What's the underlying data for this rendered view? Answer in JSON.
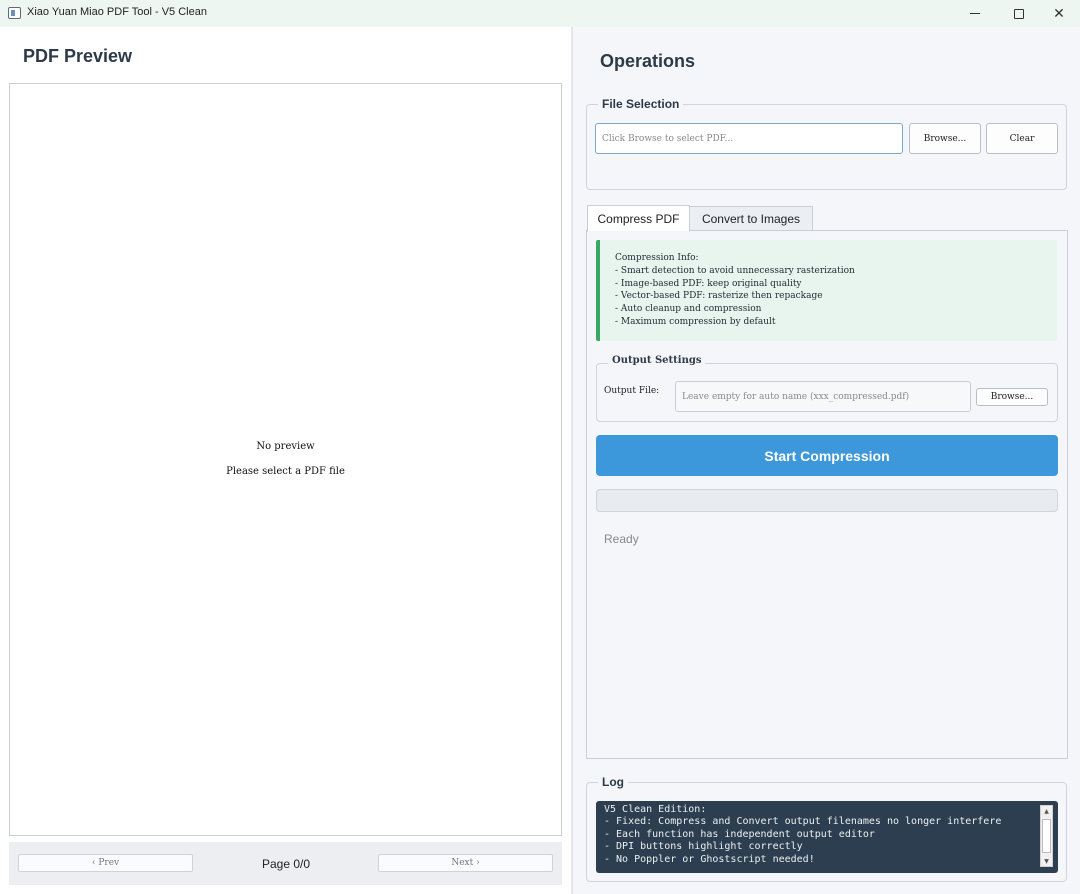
{
  "window": {
    "title": "Xiao Yuan Miao PDF Tool - V5 Clean",
    "app_icon": "pdf-app-icon",
    "close_glyph": "✕"
  },
  "preview": {
    "title": "PDF Preview",
    "empty_line1": "No preview",
    "empty_line2": "Please select a PDF file",
    "prev_label": "‹ Prev",
    "next_label": "Next ›",
    "page_label": "Page 0/0"
  },
  "operations": {
    "title": "Operations",
    "file_selection": {
      "title": "File Selection",
      "placeholder": "Click Browse to select PDF...",
      "value": "",
      "browse_label": "Browse...",
      "clear_label": "Clear"
    },
    "tabs": [
      {
        "label": "Compress PDF",
        "active": true
      },
      {
        "label": "Convert to Images",
        "active": false
      }
    ],
    "compress": {
      "info_lines": [
        "Compression Info:",
        "- Smart detection to avoid unnecessary rasterization",
        "- Image-based PDF: keep original quality",
        "- Vector-based PDF: rasterize then repackage",
        "- Auto cleanup and compression",
        "- Maximum compression by default"
      ],
      "output_settings_title": "Output Settings",
      "output_label": "Output File:",
      "output_placeholder": "Leave empty for auto name (xxx_compressed.pdf)",
      "output_value": "",
      "output_browse_label": "Browse...",
      "start_label": "Start Compression",
      "progress": 0,
      "status": "Ready"
    }
  },
  "log": {
    "title": "Log",
    "lines": [
      "V5 Clean Edition:",
      "- Fixed: Compress and Convert output filenames no longer interfere",
      "- Each function has independent output editor",
      "- DPI buttons highlight correctly",
      "- No Poppler or Ghostscript needed!"
    ]
  },
  "colors": {
    "accent": "#3c97db",
    "info_border": "#3aa864",
    "info_bg": "#e7f5ee",
    "log_bg": "#2c3e50"
  }
}
